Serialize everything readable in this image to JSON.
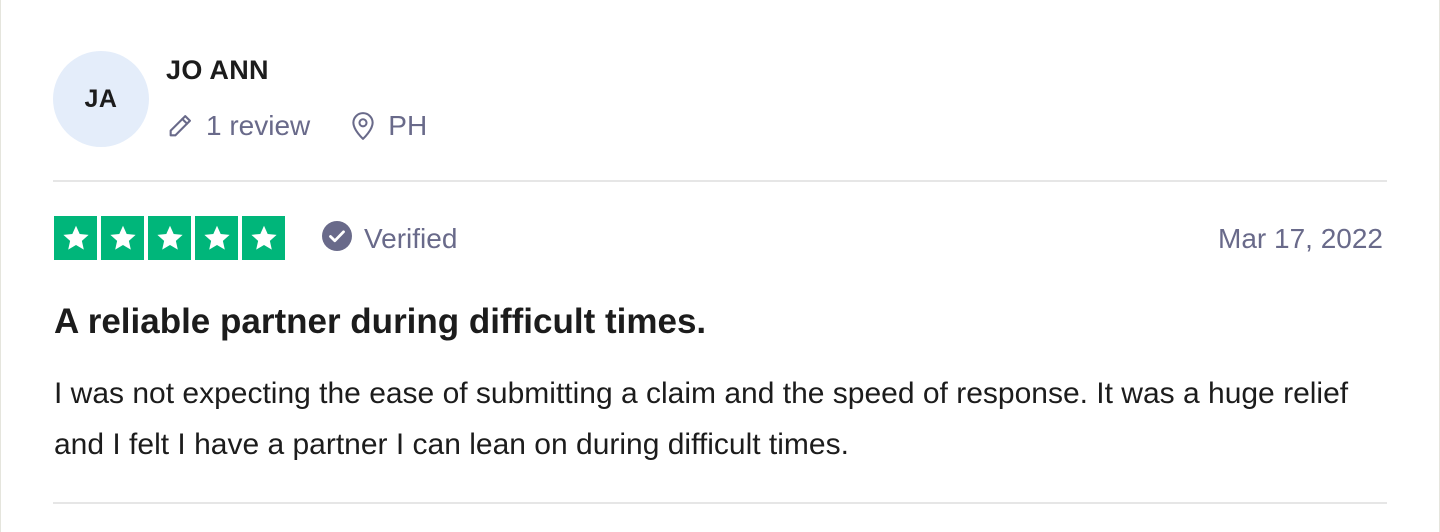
{
  "reviewer": {
    "initials": "JA",
    "name": "JO ANN",
    "review_count": "1 review",
    "location": "PH"
  },
  "rating": {
    "stars": 5,
    "max_stars": 5,
    "star_color": "#00b67a"
  },
  "badge": {
    "label": "Verified",
    "icon": "checkmark-circle-icon"
  },
  "date": "Mar 17, 2022",
  "review": {
    "title": "A reliable partner during difficult times.",
    "body": "I was not expecting the ease of submitting a claim and the speed of response. It was a huge relief and I felt I have a partner I can lean on during difficult times."
  },
  "colors": {
    "text_primary": "#1c1c1c",
    "text_secondary": "#696a8a",
    "avatar_bg": "#e4edfa",
    "divider": "#e6e6e6"
  },
  "icons": {
    "review_count": "pencil-icon",
    "location": "map-pin-icon",
    "star": "star-icon"
  }
}
